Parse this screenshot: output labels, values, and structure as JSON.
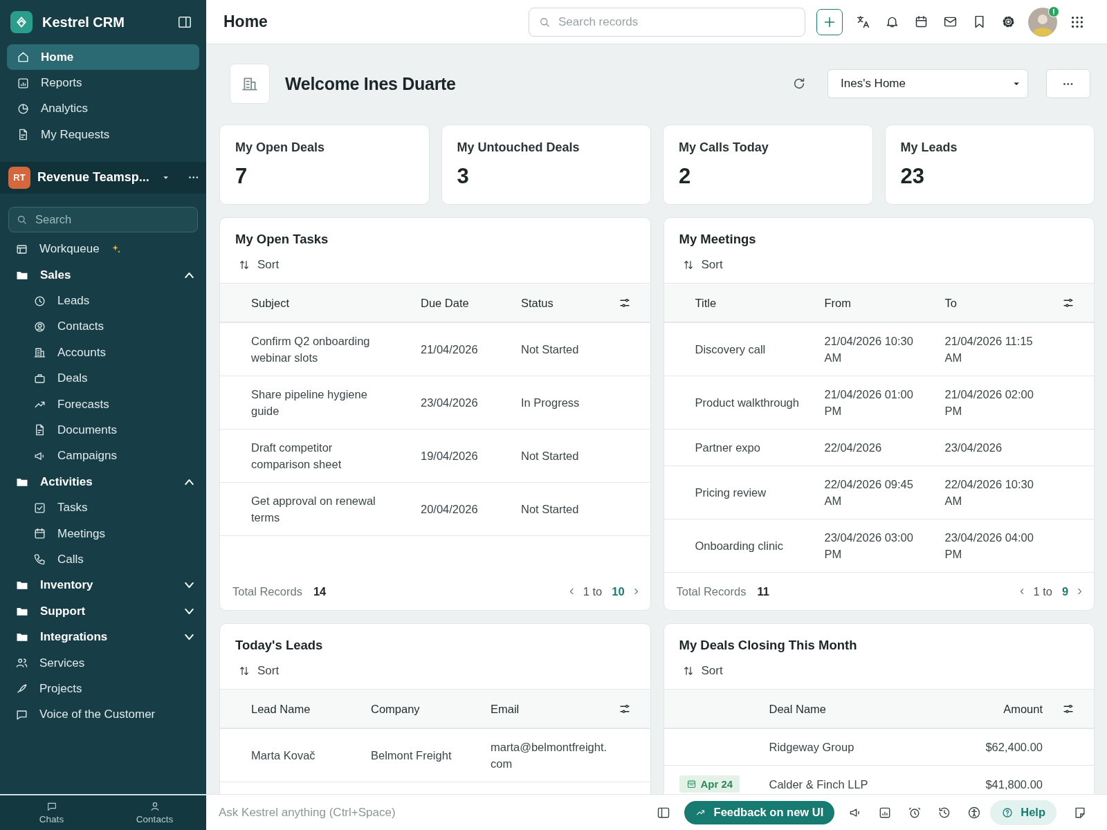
{
  "app": {
    "name": "Kestrel CRM"
  },
  "sidebar": {
    "nav": [
      {
        "label": "Home",
        "selected": true
      },
      {
        "label": "Reports",
        "selected": false
      },
      {
        "label": "Analytics",
        "selected": false
      },
      {
        "label": "My Requests",
        "selected": false
      }
    ],
    "workspace": {
      "initials": "RT",
      "name": "Revenue Teamsp..."
    },
    "search": {
      "placeholder": "Search"
    },
    "tree": [
      {
        "label": "Workqueue",
        "kind": "link",
        "sparkle": true
      },
      {
        "label": "Sales",
        "kind": "group",
        "expanded": true,
        "children": [
          {
            "label": "Leads"
          },
          {
            "label": "Contacts"
          },
          {
            "label": "Accounts"
          },
          {
            "label": "Deals"
          },
          {
            "label": "Forecasts"
          },
          {
            "label": "Documents"
          },
          {
            "label": "Campaigns"
          }
        ]
      },
      {
        "label": "Activities",
        "kind": "group",
        "expanded": true,
        "children": [
          {
            "label": "Tasks"
          },
          {
            "label": "Meetings"
          },
          {
            "label": "Calls"
          }
        ]
      },
      {
        "label": "Inventory",
        "kind": "group",
        "expanded": false
      },
      {
        "label": "Support",
        "kind": "group",
        "expanded": false
      },
      {
        "label": "Integrations",
        "kind": "group",
        "expanded": false
      },
      {
        "label": "Services",
        "kind": "link",
        "sparkle": false
      },
      {
        "label": "Projects",
        "kind": "link",
        "sparkle": false
      },
      {
        "label": "Voice of the Customer",
        "kind": "link",
        "sparkle": false
      }
    ],
    "footer": [
      {
        "label": "Chats"
      },
      {
        "label": "Contacts"
      }
    ]
  },
  "topbar": {
    "title": "Home",
    "search": {
      "placeholder": "Search records"
    }
  },
  "welcome": {
    "title": "Welcome Ines Duarte",
    "view": "Ines's Home"
  },
  "stats": [
    {
      "label": "My Open Deals",
      "value": "7"
    },
    {
      "label": "My Untouched Deals",
      "value": "3"
    },
    {
      "label": "My Calls Today",
      "value": "2"
    },
    {
      "label": "My Leads",
      "value": "23"
    }
  ],
  "panels": [
    {
      "title": "My Open Tasks",
      "kind": "plain",
      "sort": "Sort",
      "columns": [
        "Subject",
        "Due Date",
        "Status"
      ],
      "rows": [
        {
          "cells": [
            "Confirm Q2 onboarding webinar slots",
            "21/04/2026",
            "Not Started"
          ]
        },
        {
          "cells": [
            "Share pipeline hygiene guide",
            "23/04/2026",
            "In Progress"
          ]
        },
        {
          "cells": [
            "Draft competitor comparison sheet",
            "19/04/2026",
            "Not Started"
          ]
        },
        {
          "cells": [
            "Get approval on renewal terms",
            "20/04/2026",
            "Not Started"
          ]
        }
      ],
      "total_label": "Total Records",
      "total": "14",
      "range": "1 to",
      "range_end": "10"
    },
    {
      "title": "My Meetings",
      "kind": "plain",
      "sort": "Sort",
      "columns": [
        "Title",
        "From",
        "To"
      ],
      "rows": [
        {
          "cells": [
            "Discovery call",
            "21/04/2026 10:30 AM",
            "21/04/2026 11:15 AM"
          ]
        },
        {
          "cells": [
            "Product walkthrough",
            "21/04/2026 01:00 PM",
            "21/04/2026 02:00 PM"
          ]
        },
        {
          "cells": [
            "Partner expo",
            "22/04/2026",
            "23/04/2026"
          ]
        },
        {
          "cells": [
            "Pricing review",
            "22/04/2026 09:45 AM",
            "22/04/2026 10:30 AM"
          ]
        },
        {
          "cells": [
            "Onboarding clinic",
            "23/04/2026 03:00 PM",
            "23/04/2026 04:00 PM"
          ]
        }
      ],
      "total_label": "Total Records",
      "total": "11",
      "range": "1 to",
      "range_end": "9"
    },
    {
      "title": "Today's Leads",
      "kind": "plain",
      "sort": "Sort",
      "columns": [
        "Lead Name",
        "Company",
        "Email"
      ],
      "rows": [
        {
          "cells": [
            "Marta Kovač",
            "Belmont Freight",
            "marta@belmontfreight.com"
          ]
        }
      ]
    },
    {
      "title": "My Deals Closing This Month",
      "kind": "tagged",
      "sort": "Sort",
      "columns": [
        "Deal Name",
        "Amount"
      ],
      "rows": [
        {
          "cells": [
            "Ridgeway Group",
            "$62,400.00"
          ]
        },
        {
          "tag": "Apr 24",
          "cells": [
            "Calder & Finch LLP",
            "$41,800.00"
          ]
        }
      ]
    }
  ],
  "assistant": {
    "placeholder": "Ask Kestrel anything (Ctrl+Space)"
  },
  "feedback": "Feedback on new UI",
  "help": "Help"
}
